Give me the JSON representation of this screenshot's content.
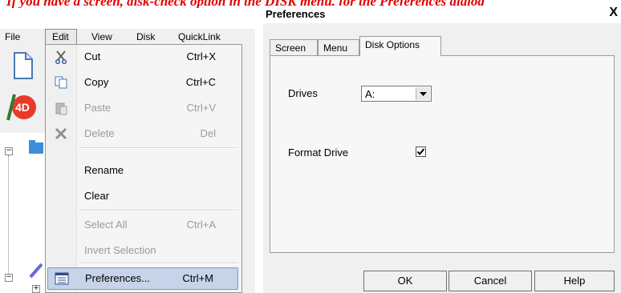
{
  "banner": {
    "text": "If you have a screen, disk-check option in the DISK menu, for the Preferences dialog"
  },
  "app": {
    "menubar": {
      "items": [
        {
          "label": "File"
        },
        {
          "label": "Edit"
        },
        {
          "label": "View"
        },
        {
          "label": "Disk"
        },
        {
          "label": "QuickLink"
        }
      ]
    },
    "toolbar": {
      "new_icon": "new-document-icon",
      "app_icon": "4d-app-icon"
    },
    "tree": {
      "node_icon": "folder-icon",
      "expand_glyph": "+"
    }
  },
  "edit_menu": {
    "items": [
      {
        "label": "Cut",
        "shortcut": "Ctrl+X",
        "icon": "scissors-icon",
        "enabled": true
      },
      {
        "label": "Copy",
        "shortcut": "Ctrl+C",
        "icon": "copy-icon",
        "enabled": true
      },
      {
        "label": "Paste",
        "shortcut": "Ctrl+V",
        "icon": "paste-icon",
        "enabled": false
      },
      {
        "label": "Delete",
        "shortcut": "Del",
        "icon": "delete-x-icon",
        "enabled": false
      },
      {
        "label": "Rename",
        "shortcut": "",
        "enabled": true
      },
      {
        "label": "Clear",
        "shortcut": "",
        "enabled": true
      },
      {
        "label": "Select All",
        "shortcut": "Ctrl+A",
        "enabled": false
      },
      {
        "label": "Invert Selection",
        "shortcut": "",
        "enabled": false
      },
      {
        "label": "Preferences...",
        "shortcut": "Ctrl+M",
        "icon": "preferences-icon",
        "enabled": true,
        "highlighted": true
      }
    ]
  },
  "dialog": {
    "title": "Preferences",
    "close_glyph": "X",
    "tabs": [
      {
        "label": "Screen"
      },
      {
        "label": "Menu"
      },
      {
        "label": "Disk Options",
        "selected": true
      }
    ],
    "drives": {
      "label": "Drives",
      "value": "A:"
    },
    "format_drive": {
      "label": "Format Drive",
      "checked": true
    },
    "buttons": {
      "ok": "OK",
      "cancel": "Cancel",
      "help": "Help"
    }
  },
  "colors": {
    "banner": "#e00000",
    "highlight": "#c6d3e8",
    "highlight_border": "#7b99c7"
  }
}
